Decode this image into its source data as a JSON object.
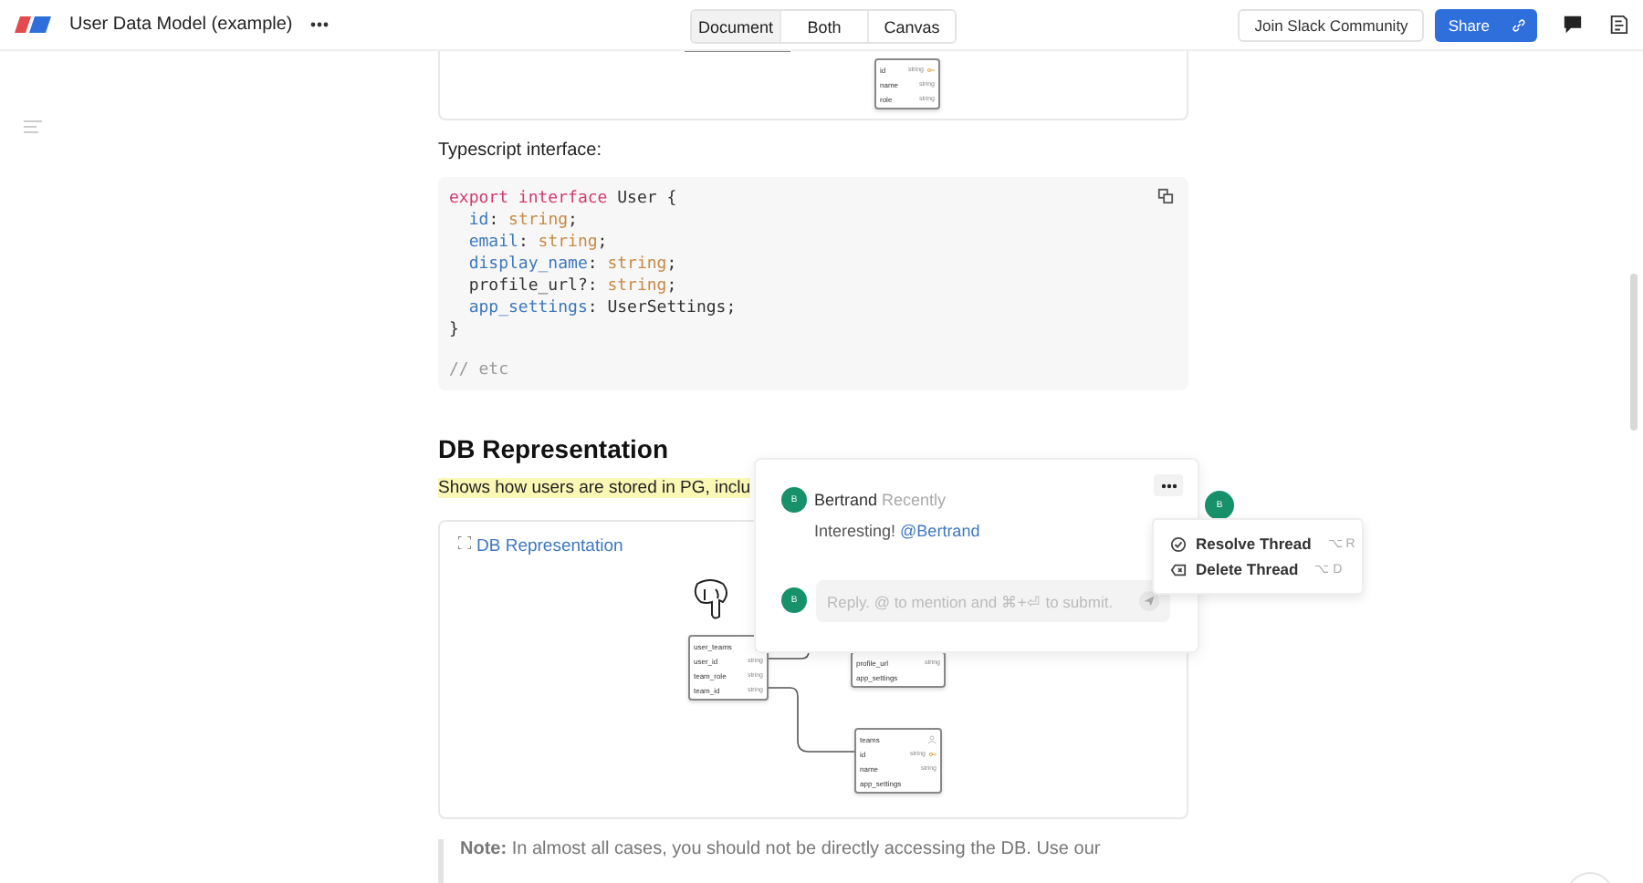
{
  "header": {
    "title": "User Data Model (example)",
    "view_tabs": [
      {
        "label": "Document",
        "selected": true
      },
      {
        "label": "Both",
        "selected": false
      },
      {
        "label": "Canvas",
        "selected": false
      }
    ],
    "join_button": "Join Slack Community",
    "share_button": "Share"
  },
  "top_diagram": {
    "nodes": [
      {
        "fields": [
          {
            "name": "id",
            "type": "string",
            "primary_key": true
          },
          {
            "name": "name",
            "type": "string",
            "primary_key": false
          },
          {
            "name": "role",
            "type": "string",
            "primary_key": false
          }
        ]
      }
    ]
  },
  "intro": "Typescript interface:",
  "code": {
    "lines": [
      {
        "kind": "code",
        "tokens": [
          {
            "kind": "keyword",
            "text": "export interface"
          },
          {
            "kind": "plain",
            "text": " User {"
          }
        ]
      },
      {
        "kind": "code",
        "tokens": [
          {
            "kind": "prop",
            "text": "  id"
          },
          {
            "kind": "plain",
            "text": ": "
          },
          {
            "kind": "type",
            "text": "string"
          },
          {
            "kind": "plain",
            "text": ";"
          }
        ]
      },
      {
        "kind": "code",
        "tokens": [
          {
            "kind": "prop",
            "text": "  email"
          },
          {
            "kind": "plain",
            "text": ": "
          },
          {
            "kind": "type",
            "text": "string"
          },
          {
            "kind": "plain",
            "text": ";"
          }
        ]
      },
      {
        "kind": "code",
        "tokens": [
          {
            "kind": "prop",
            "text": "  display_name"
          },
          {
            "kind": "plain",
            "text": ": "
          },
          {
            "kind": "type",
            "text": "string"
          },
          {
            "kind": "plain",
            "text": ";"
          }
        ]
      },
      {
        "kind": "code",
        "tokens": [
          {
            "kind": "plain",
            "text": "  profile_url?: "
          },
          {
            "kind": "type",
            "text": "string"
          },
          {
            "kind": "plain",
            "text": ";"
          }
        ]
      },
      {
        "kind": "code",
        "tokens": [
          {
            "kind": "prop",
            "text": "  app_settings"
          },
          {
            "kind": "plain",
            "text": ": UserSettings;"
          }
        ]
      },
      {
        "kind": "code",
        "tokens": [
          {
            "kind": "plain",
            "text": "}"
          }
        ]
      },
      {
        "kind": "blank"
      },
      {
        "kind": "code",
        "tokens": [
          {
            "kind": "comment",
            "text": "// etc"
          }
        ]
      }
    ]
  },
  "heading": "DB Representation",
  "paragraph": {
    "text": "Shows how users are stored in PG, inclu",
    "highlighted": true
  },
  "embed": {
    "link": "DB Representation",
    "diagram": {
      "nodes": [
        {
          "title": "user_teams",
          "fields": [
            {
              "name": "user_id",
              "type": "string",
              "primary_key": false
            },
            {
              "name": "team_role",
              "type": "string",
              "primary_key": false
            },
            {
              "name": "team_id",
              "type": "string",
              "primary_key": false
            }
          ]
        },
        {
          "fields": [
            {
              "name": "profile_url",
              "type": "string",
              "primary_key": false
            },
            {
              "name": "app_settings",
              "primary_key": false
            }
          ]
        },
        {
          "title": "teams",
          "fields": [
            {
              "name": "id",
              "type": "string",
              "primary_key": true
            },
            {
              "name": "name",
              "type": "string",
              "primary_key": false
            },
            {
              "name": "app_settings",
              "primary_key": false
            }
          ]
        }
      ]
    }
  },
  "note": "**Note:**  In almost all cases, you should not be directly accessing the DB. Use our",
  "comment": {
    "avatar": "B",
    "author": "Bertrand",
    "time": "Recently",
    "body": "Interesting!",
    "mention": "@Bertrand",
    "reply_avatar": "B",
    "reply_placeholder": "Reply. @ to mention and ⌘+⏎ to submit."
  },
  "floating_avatar": "B",
  "thread_menu": [
    {
      "kind": "resolve",
      "label": "Resolve Thread",
      "shortcut": "⌥ R"
    },
    {
      "kind": "delete",
      "label": "Delete Thread",
      "shortcut": "⌥ D"
    }
  ]
}
